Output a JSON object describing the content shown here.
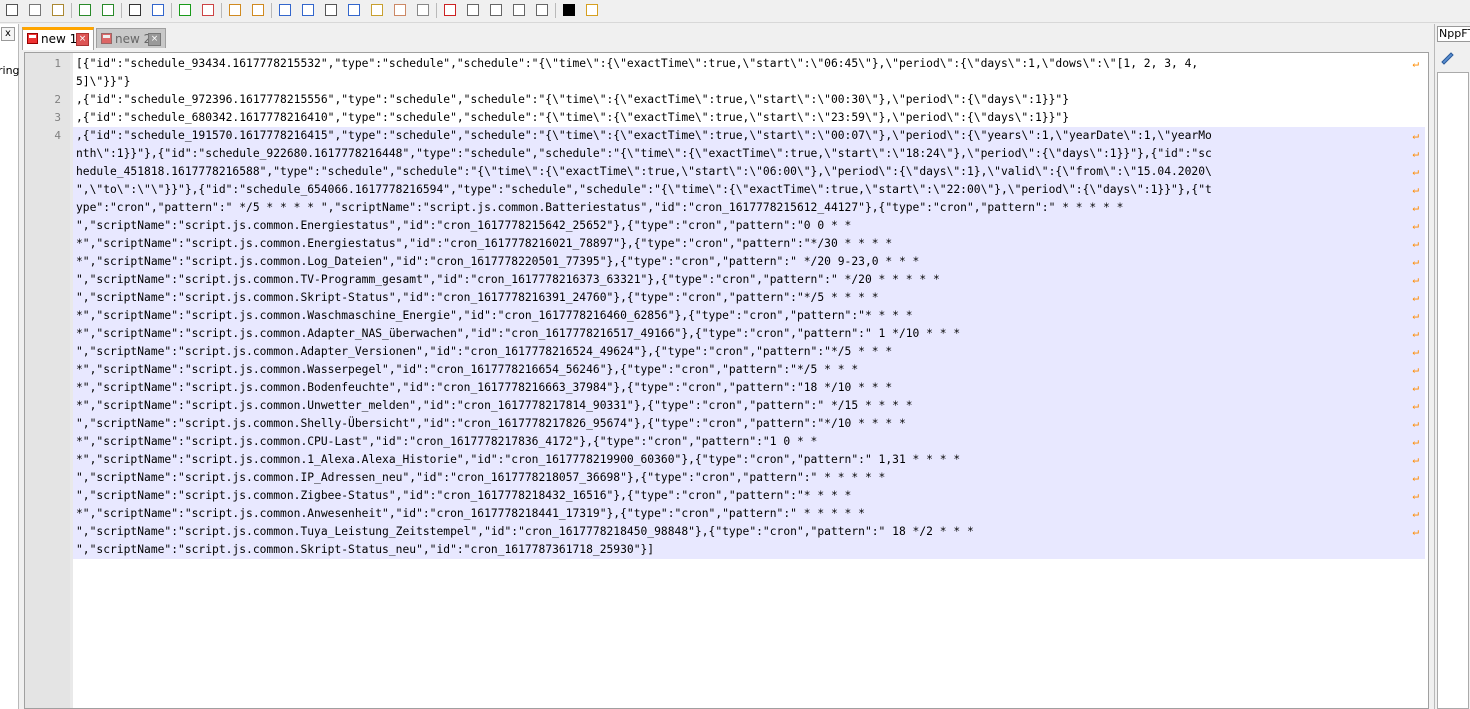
{
  "toolbar": {
    "icons": [
      "cut-icon",
      "copy-icon",
      "paste-icon",
      "undo-icon",
      "redo-icon",
      "find-icon",
      "replace-icon",
      "zoom-in-icon",
      "zoom-out-icon",
      "sync-vertical-icon",
      "sync-horizontal-icon",
      "word-wrap-icon",
      "show-all-chars-icon",
      "indent-guide-icon",
      "function-list-icon",
      "document-map-icon",
      "folder-as-workspace-icon",
      "monitoring-icon",
      "record-macro-icon",
      "stop-macro-icon",
      "play-macro-icon",
      "run-macro-multiple-icon",
      "save-macro-icon",
      "json-viewer-icon",
      "nppftp-icon"
    ]
  },
  "left_panel": {
    "close_label": "x",
    "text": "ring"
  },
  "tabs": [
    {
      "label": "new 1",
      "active": true
    },
    {
      "label": "new 2",
      "active": false
    }
  ],
  "right_panel": {
    "title": "NppFT"
  },
  "editor": {
    "line_numbers": [
      "1",
      "2",
      "3",
      "4"
    ],
    "rows": [
      {
        "text": "[{\"id\":\"schedule_93434.1617778215532\",\"type\":\"schedule\",\"schedule\":\"{\\\"time\\\":{\\\"exactTime\\\":true,\\\"start\\\":\\\"06:45\\\"},\\\"period\\\":{\\\"days\\\":1,\\\"dows\\\":\\\"[1, 2, 3, 4,",
        "wrap": true,
        "sel": false
      },
      {
        "text": "5]\\\"}}\"}",
        "wrap": false,
        "sel": false
      },
      {
        "text": ",{\"id\":\"schedule_972396.1617778215556\",\"type\":\"schedule\",\"schedule\":\"{\\\"time\\\":{\\\"exactTime\\\":true,\\\"start\\\":\\\"00:30\\\"},\\\"period\\\":{\\\"days\\\":1}}\"}",
        "wrap": false,
        "sel": false
      },
      {
        "text": ",{\"id\":\"schedule_680342.1617778216410\",\"type\":\"schedule\",\"schedule\":\"{\\\"time\\\":{\\\"exactTime\\\":true,\\\"start\\\":\\\"23:59\\\"},\\\"period\\\":{\\\"days\\\":1}}\"}",
        "wrap": false,
        "sel": false
      },
      {
        "text": ",{\"id\":\"schedule_191570.1617778216415\",\"type\":\"schedule\",\"schedule\":\"{\\\"time\\\":{\\\"exactTime\\\":true,\\\"start\\\":\\\"00:07\\\"},\\\"period\\\":{\\\"years\\\":1,\\\"yearDate\\\":1,\\\"yearMo",
        "wrap": true,
        "sel": true
      },
      {
        "text": "nth\\\":1}}\"},{\"id\":\"schedule_922680.1617778216448\",\"type\":\"schedule\",\"schedule\":\"{\\\"time\\\":{\\\"exactTime\\\":true,\\\"start\\\":\\\"18:24\\\"},\\\"period\\\":{\\\"days\\\":1}}\"},{\"id\":\"sc",
        "wrap": true,
        "sel": true
      },
      {
        "text": "hedule_451818.1617778216588\",\"type\":\"schedule\",\"schedule\":\"{\\\"time\\\":{\\\"exactTime\\\":true,\\\"start\\\":\\\"06:00\\\"},\\\"period\\\":{\\\"days\\\":1},\\\"valid\\\":{\\\"from\\\":\\\"15.04.2020\\",
        "wrap": true,
        "sel": true
      },
      {
        "text": "\",\\\"to\\\":\\\"\\\"}}\"},{\"id\":\"schedule_654066.1617778216594\",\"type\":\"schedule\",\"schedule\":\"{\\\"time\\\":{\\\"exactTime\\\":true,\\\"start\\\":\\\"22:00\\\"},\\\"period\\\":{\\\"days\\\":1}}\"},{\"t",
        "wrap": true,
        "sel": true
      },
      {
        "text": "ype\":\"cron\",\"pattern\":\" */5 * * * * \",\"scriptName\":\"script.js.common.Batteriestatus\",\"id\":\"cron_1617778215612_44127\"},{\"type\":\"cron\",\"pattern\":\" * * * * *",
        "wrap": true,
        "sel": true
      },
      {
        "text": "\",\"scriptName\":\"script.js.common.Energiestatus\",\"id\":\"cron_1617778215642_25652\"},{\"type\":\"cron\",\"pattern\":\"0 0 * *",
        "wrap": true,
        "sel": true
      },
      {
        "text": "*\",\"scriptName\":\"script.js.common.Energiestatus\",\"id\":\"cron_1617778216021_78897\"},{\"type\":\"cron\",\"pattern\":\"*/30 * * * *",
        "wrap": true,
        "sel": true
      },
      {
        "text": "*\",\"scriptName\":\"script.js.common.Log_Dateien\",\"id\":\"cron_1617778220501_77395\"},{\"type\":\"cron\",\"pattern\":\" */20 9-23,0 * * *",
        "wrap": true,
        "sel": true
      },
      {
        "text": "\",\"scriptName\":\"script.js.common.TV-Programm_gesamt\",\"id\":\"cron_1617778216373_63321\"},{\"type\":\"cron\",\"pattern\":\" */20 * * * * *",
        "wrap": true,
        "sel": true
      },
      {
        "text": "\",\"scriptName\":\"script.js.common.Skript-Status\",\"id\":\"cron_1617778216391_24760\"},{\"type\":\"cron\",\"pattern\":\"*/5 * * * *",
        "wrap": true,
        "sel": true
      },
      {
        "text": "*\",\"scriptName\":\"script.js.common.Waschmaschine_Energie\",\"id\":\"cron_1617778216460_62856\"},{\"type\":\"cron\",\"pattern\":\"* * * *",
        "wrap": true,
        "sel": true
      },
      {
        "text": "*\",\"scriptName\":\"script.js.common.Adapter_NAS_überwachen\",\"id\":\"cron_1617778216517_49166\"},{\"type\":\"cron\",\"pattern\":\" 1 */10 * * *",
        "wrap": true,
        "sel": true
      },
      {
        "text": "\",\"scriptName\":\"script.js.common.Adapter_Versionen\",\"id\":\"cron_1617778216524_49624\"},{\"type\":\"cron\",\"pattern\":\"*/5 * * *",
        "wrap": true,
        "sel": true
      },
      {
        "text": "*\",\"scriptName\":\"script.js.common.Wasserpegel\",\"id\":\"cron_1617778216654_56246\"},{\"type\":\"cron\",\"pattern\":\"*/5 * * *",
        "wrap": true,
        "sel": true
      },
      {
        "text": "*\",\"scriptName\":\"script.js.common.Bodenfeuchte\",\"id\":\"cron_1617778216663_37984\"},{\"type\":\"cron\",\"pattern\":\"18 */10 * * *",
        "wrap": true,
        "sel": true
      },
      {
        "text": "*\",\"scriptName\":\"script.js.common.Unwetter_melden\",\"id\":\"cron_1617778217814_90331\"},{\"type\":\"cron\",\"pattern\":\" */15 * * * *",
        "wrap": true,
        "sel": true
      },
      {
        "text": "\",\"scriptName\":\"script.js.common.Shelly-Übersicht\",\"id\":\"cron_1617778217826_95674\"},{\"type\":\"cron\",\"pattern\":\"*/10 * * * *",
        "wrap": true,
        "sel": true
      },
      {
        "text": "*\",\"scriptName\":\"script.js.common.CPU-Last\",\"id\":\"cron_1617778217836_4172\"},{\"type\":\"cron\",\"pattern\":\"1 0 * *",
        "wrap": true,
        "sel": true
      },
      {
        "text": "*\",\"scriptName\":\"script.js.common.1_Alexa.Alexa_Historie\",\"id\":\"cron_1617778219900_60360\"},{\"type\":\"cron\",\"pattern\":\" 1,31 * * * *",
        "wrap": true,
        "sel": true
      },
      {
        "text": "\",\"scriptName\":\"script.js.common.IP_Adressen_neu\",\"id\":\"cron_1617778218057_36698\"},{\"type\":\"cron\",\"pattern\":\" * * * * *",
        "wrap": true,
        "sel": true
      },
      {
        "text": "\",\"scriptName\":\"script.js.common.Zigbee-Status\",\"id\":\"cron_1617778218432_16516\"},{\"type\":\"cron\",\"pattern\":\"* * * *",
        "wrap": true,
        "sel": true
      },
      {
        "text": "*\",\"scriptName\":\"script.js.common.Anwesenheit\",\"id\":\"cron_1617778218441_17319\"},{\"type\":\"cron\",\"pattern\":\" * * * * *",
        "wrap": true,
        "sel": true
      },
      {
        "text": "\",\"scriptName\":\"script.js.common.Tuya_Leistung_Zeitstempel\",\"id\":\"cron_1617778218450_98848\"},{\"type\":\"cron\",\"pattern\":\" 18 */2 * * *",
        "wrap": true,
        "sel": true
      },
      {
        "text": "\",\"scriptName\":\"script.js.common.Skript-Status_neu\",\"id\":\"cron_1617787361718_25930\"}]",
        "wrap": false,
        "sel": true
      }
    ]
  },
  "colors": {
    "selection": "#e8e8ff",
    "wrap_symbol": "#ff8c00",
    "active_tab_accent": "#ffa500"
  }
}
